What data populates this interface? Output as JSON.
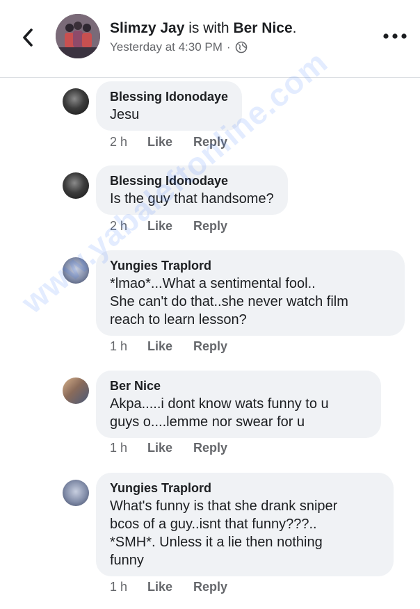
{
  "post": {
    "author": "Slimzy Jay",
    "with_text": "is with",
    "tagged": "Ber Nice",
    "timestamp": "Yesterday at 4:30 PM"
  },
  "icons": {
    "back": "chevron-left-icon",
    "more": "more-dots-icon",
    "privacy": "globe-icon"
  },
  "comments": [
    {
      "name": "Blessing Idonodaye",
      "lines": [
        "Jesu"
      ],
      "time": "2 h",
      "like": "Like",
      "reply": "Reply"
    },
    {
      "name": "Blessing Idonodaye",
      "lines": [
        "Is the guy that handsome?"
      ],
      "time": "2 h",
      "like": "Like",
      "reply": "Reply"
    },
    {
      "name": "Yungies Traplord",
      "lines": [
        "*lmao*...What a sentimental fool..",
        "She can't do that..she never watch film",
        "reach to learn lesson?"
      ],
      "time": "1 h",
      "like": "Like",
      "reply": "Reply"
    },
    {
      "name": "Ber Nice",
      "lines": [
        "Akpa.....i dont know wats funny to u",
        "guys o....lemme nor swear for u"
      ],
      "time": "1 h",
      "like": "Like",
      "reply": "Reply"
    },
    {
      "name": "Yungies Traplord",
      "lines": [
        "What's funny is that she drank sniper",
        "bcos of a guy..isnt that funny???..",
        "*SMH*. Unless it a lie then nothing",
        "funny"
      ],
      "time": "1 h",
      "like": "Like",
      "reply": "Reply"
    }
  ],
  "watermark": "www.yabaleftonline.com",
  "colors": {
    "bubble": "#f0f2f5",
    "meta_text": "#65676b",
    "watermark": "#286eff"
  }
}
